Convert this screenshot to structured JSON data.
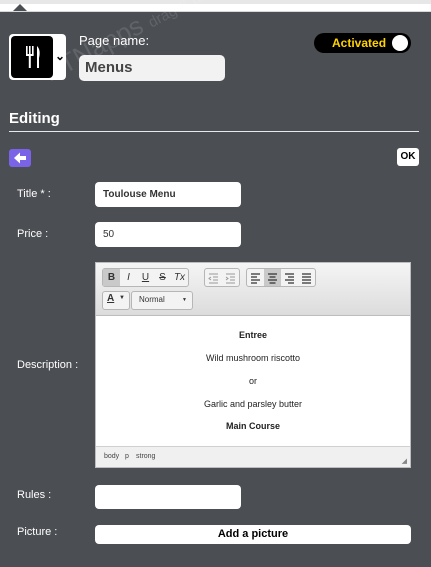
{
  "header": {
    "page_name_label": "Page name:",
    "page_name_value": "Menus",
    "toggle_label": "Activated",
    "page_icon": "fork-knife-icon"
  },
  "section": {
    "title": "Editing",
    "ok_label": "OK"
  },
  "form": {
    "title_label": "Title * :",
    "title_value": "Toulouse Menu",
    "price_label": "Price :",
    "price_value": "50",
    "description_label": "Description :",
    "rules_label": "Rules :",
    "rules_value": "",
    "picture_label": "Picture :",
    "add_picture_label": "Add a picture"
  },
  "editor": {
    "toolbar": {
      "bold": "B",
      "italic": "I",
      "underline": "U",
      "strike": "S",
      "remove_format": "Tx",
      "font_color": "A",
      "format_select": "Normal"
    },
    "content": [
      "Entree",
      "Wild mushroom riscotto",
      "or",
      "Garlic and parsley butter",
      "Main Course"
    ],
    "path": [
      "body",
      "p",
      "strong"
    ]
  },
  "watermark": {
    "brand": "ATNapps",
    "tagline": "drag & drop mobile app builder"
  },
  "colors": {
    "panel": "#4b4e52",
    "toggle_text": "#ffd200",
    "back_button": "#7a63e6"
  }
}
